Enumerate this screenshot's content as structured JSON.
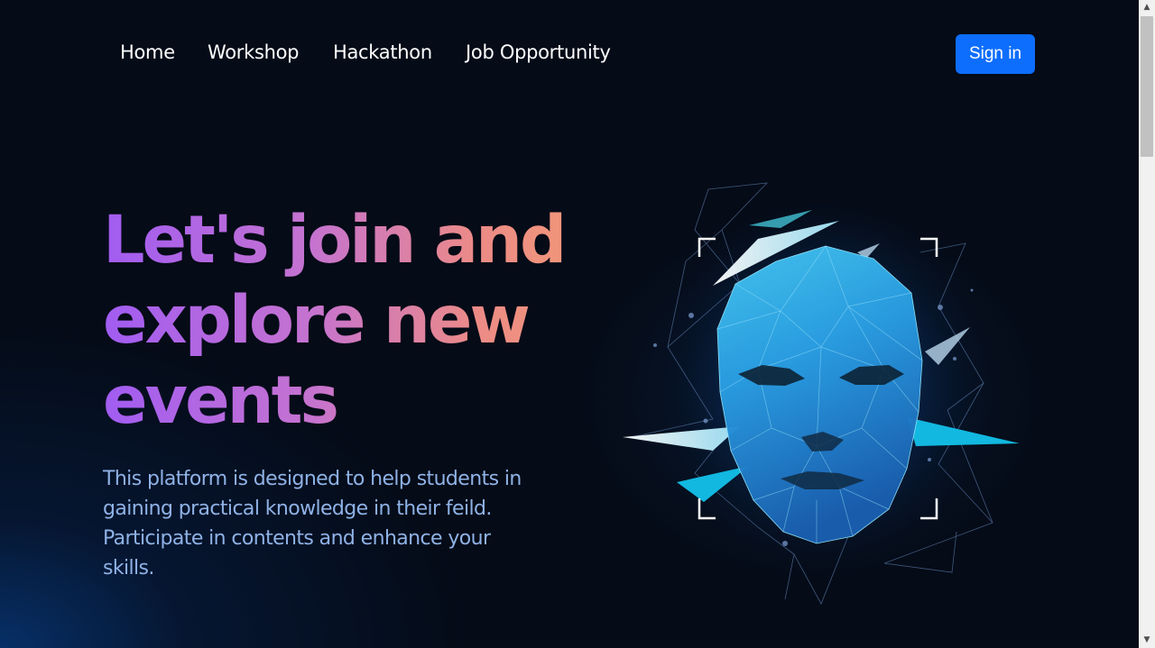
{
  "nav": {
    "links": [
      {
        "label": "Home"
      },
      {
        "label": "Workshop"
      },
      {
        "label": "Hackathon"
      },
      {
        "label": "Job Opportunity"
      }
    ],
    "signin_label": "Sign in"
  },
  "hero": {
    "title_lines": [
      "Let's join and",
      "explore new",
      "events"
    ],
    "description": "This platform is designed to help students in gaining practical knowledge in their feild. Participate in contents and enhance your skills."
  },
  "illustration": {
    "icon": "polygon-face-icon",
    "colors": {
      "face_light": "#3fc6f2",
      "face_dark": "#1a5fb0",
      "accent": "#12b8e0"
    }
  },
  "scrollbar": {
    "up_icon": "▲",
    "down_icon": "▼"
  },
  "colors": {
    "background": "#050b17",
    "signin_button": "#0d6efd",
    "title_gradient_start": "#a15cf2",
    "title_gradient_end": "#f1967a",
    "description_text": "#8fb2e6"
  }
}
